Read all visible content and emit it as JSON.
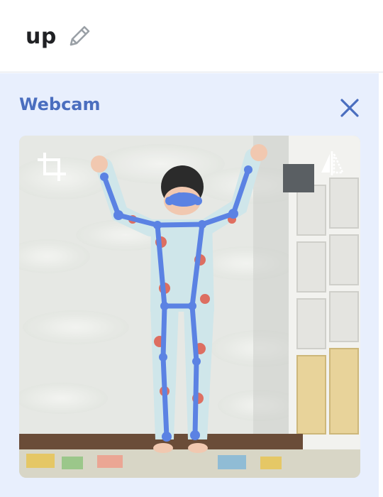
{
  "header": {
    "class_name": "up",
    "edit_icon": "pencil-icon"
  },
  "panel": {
    "title": "Webcam",
    "close_icon": "close-icon",
    "crop_icon": "crop-icon",
    "flip_icon": "flip-horizontal-icon"
  },
  "colors": {
    "accent": "#4a6ebf",
    "panel_bg": "#e8effd",
    "skeleton": "#5b82e3"
  }
}
